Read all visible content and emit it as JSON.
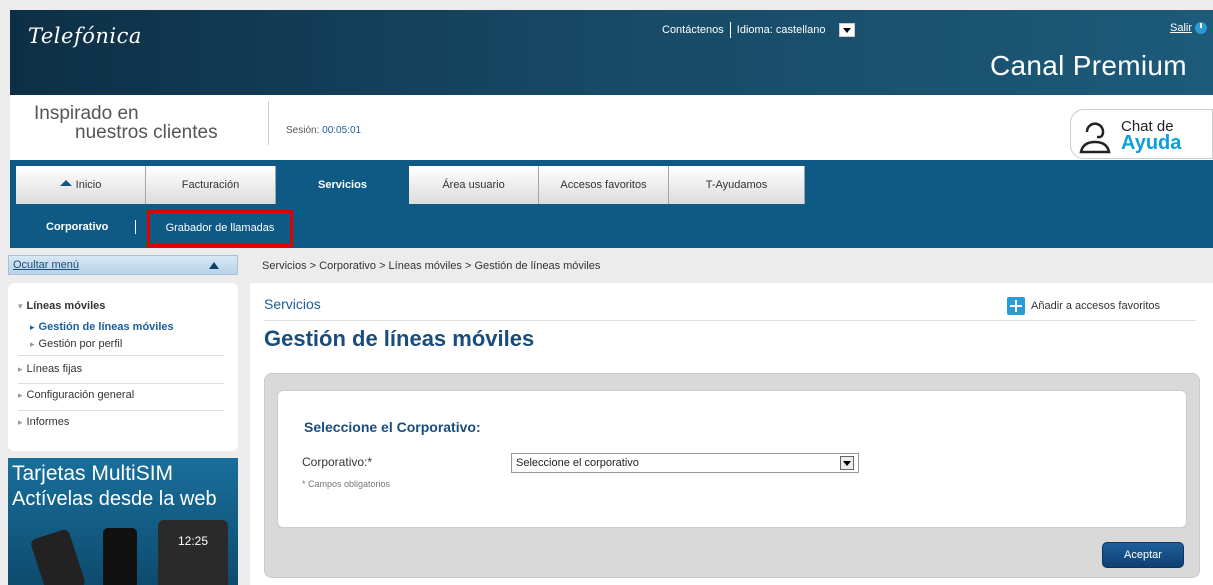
{
  "header": {
    "logo": "Telefónica",
    "contact": "Contáctenos",
    "language_label": "Idioma:",
    "language_value": "castellano",
    "logout": "Salir",
    "canal": "Canal Premium"
  },
  "slogan": {
    "line1": "Inspirado en",
    "line2": "nuestros clientes",
    "session_label": "Sesión:",
    "session_value": "00:05:01"
  },
  "chat": {
    "line1": "Chat de",
    "line2": "Ayuda"
  },
  "nav": {
    "tabs": [
      {
        "label": "Inicio"
      },
      {
        "label": "Facturación"
      },
      {
        "label": "Servicios"
      },
      {
        "label": "Área usuario"
      },
      {
        "label": "Accesos favoritos"
      },
      {
        "label": "T-Ayudamos"
      }
    ]
  },
  "subnav": {
    "item1": "Corporativo",
    "item2": "Grabador de llamadas"
  },
  "sidebar": {
    "toggle": "Ocultar menú",
    "items": [
      {
        "label": "Líneas móviles"
      },
      {
        "label": "Gestión de líneas móviles"
      },
      {
        "label": "Gestión por perfil"
      },
      {
        "label": "Líneas fijas"
      },
      {
        "label": "Configuración general"
      },
      {
        "label": "Informes"
      }
    ],
    "banner_line1": "Tarjetas MultiSIM",
    "banner_line2": "Actívelas desde la web",
    "banner_time": "12:25"
  },
  "main": {
    "breadcrumb": "Servicios > Corporativo > Líneas móviles > Gestión de líneas móviles",
    "section": "Servicios",
    "add_favorites": "Añadir a accesos favoritos",
    "title": "Gestión de líneas móviles",
    "form_heading": "Seleccione el Corporativo:",
    "corp_label": "Corporativo:*",
    "corp_select": "Seleccione el corporativo",
    "required_note": "* Campos obligatorios",
    "accept": "Aceptar"
  },
  "colors": {
    "nav_blue": "#0f5a84",
    "title_blue": "#1a4c7c",
    "highlight_red": "#e00000"
  }
}
